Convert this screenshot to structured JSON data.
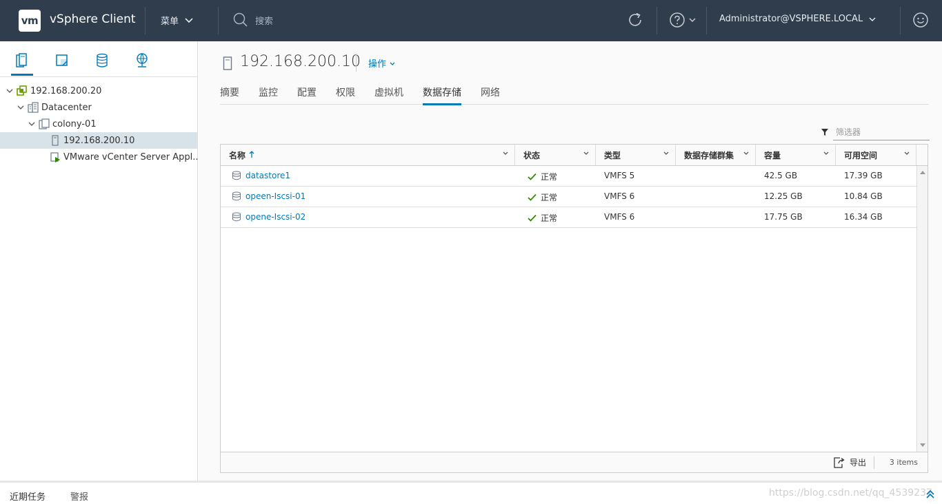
{
  "header": {
    "logo": "vm",
    "app_title": "vSphere Client",
    "menu_label": "菜单",
    "search_placeholder": "搜索",
    "user_label": "Administrator@VSPHERE.LOCAL"
  },
  "navigator": {
    "tabs": [
      "hosts-clusters",
      "vms-templates",
      "storage",
      "networking"
    ],
    "tree": [
      {
        "label": "192.168.200.20",
        "icon": "vcenter-icon",
        "expanded": true
      },
      {
        "label": "Datacenter",
        "icon": "datacenter-icon",
        "expanded": true
      },
      {
        "label": "colony-01",
        "icon": "cluster-icon",
        "expanded": true
      },
      {
        "label": "192.168.200.10",
        "icon": "host-icon",
        "selected": true
      },
      {
        "label": "VMware vCenter Server Appl...",
        "icon": "vm-icon"
      }
    ]
  },
  "main": {
    "object_title": "192.168.200.10",
    "actions_label": "操作",
    "tabs": [
      "摘要",
      "监控",
      "配置",
      "权限",
      "虚拟机",
      "数据存储",
      "网络"
    ],
    "active_tab": "数据存储",
    "filter_placeholder": "筛选器",
    "columns": [
      "名称",
      "状态",
      "类型",
      "数据存储群集",
      "容量",
      "可用空间"
    ],
    "rows": [
      {
        "name": "datastore1",
        "status": "正常",
        "type": "VMFS 5",
        "cluster": "",
        "capacity": "42.5 GB",
        "free": "17.39 GB"
      },
      {
        "name": "opeen-Iscsi-01",
        "status": "正常",
        "type": "VMFS 6",
        "cluster": "",
        "capacity": "12.25 GB",
        "free": "10.84 GB"
      },
      {
        "name": "opene-Iscsi-02",
        "status": "正常",
        "type": "VMFS 6",
        "cluster": "",
        "capacity": "17.75 GB",
        "free": "16.34 GB"
      }
    ],
    "export_label": "导出",
    "item_count": "3 items"
  },
  "bottom": {
    "recent_tasks": "近期任务",
    "alarms": "警报",
    "watermark": "https://blog.csdn.net/qq_4539237"
  },
  "colors": {
    "header_bg": "#2f3d4d",
    "accent": "#0079b8",
    "ok_green": "#2f8400"
  }
}
